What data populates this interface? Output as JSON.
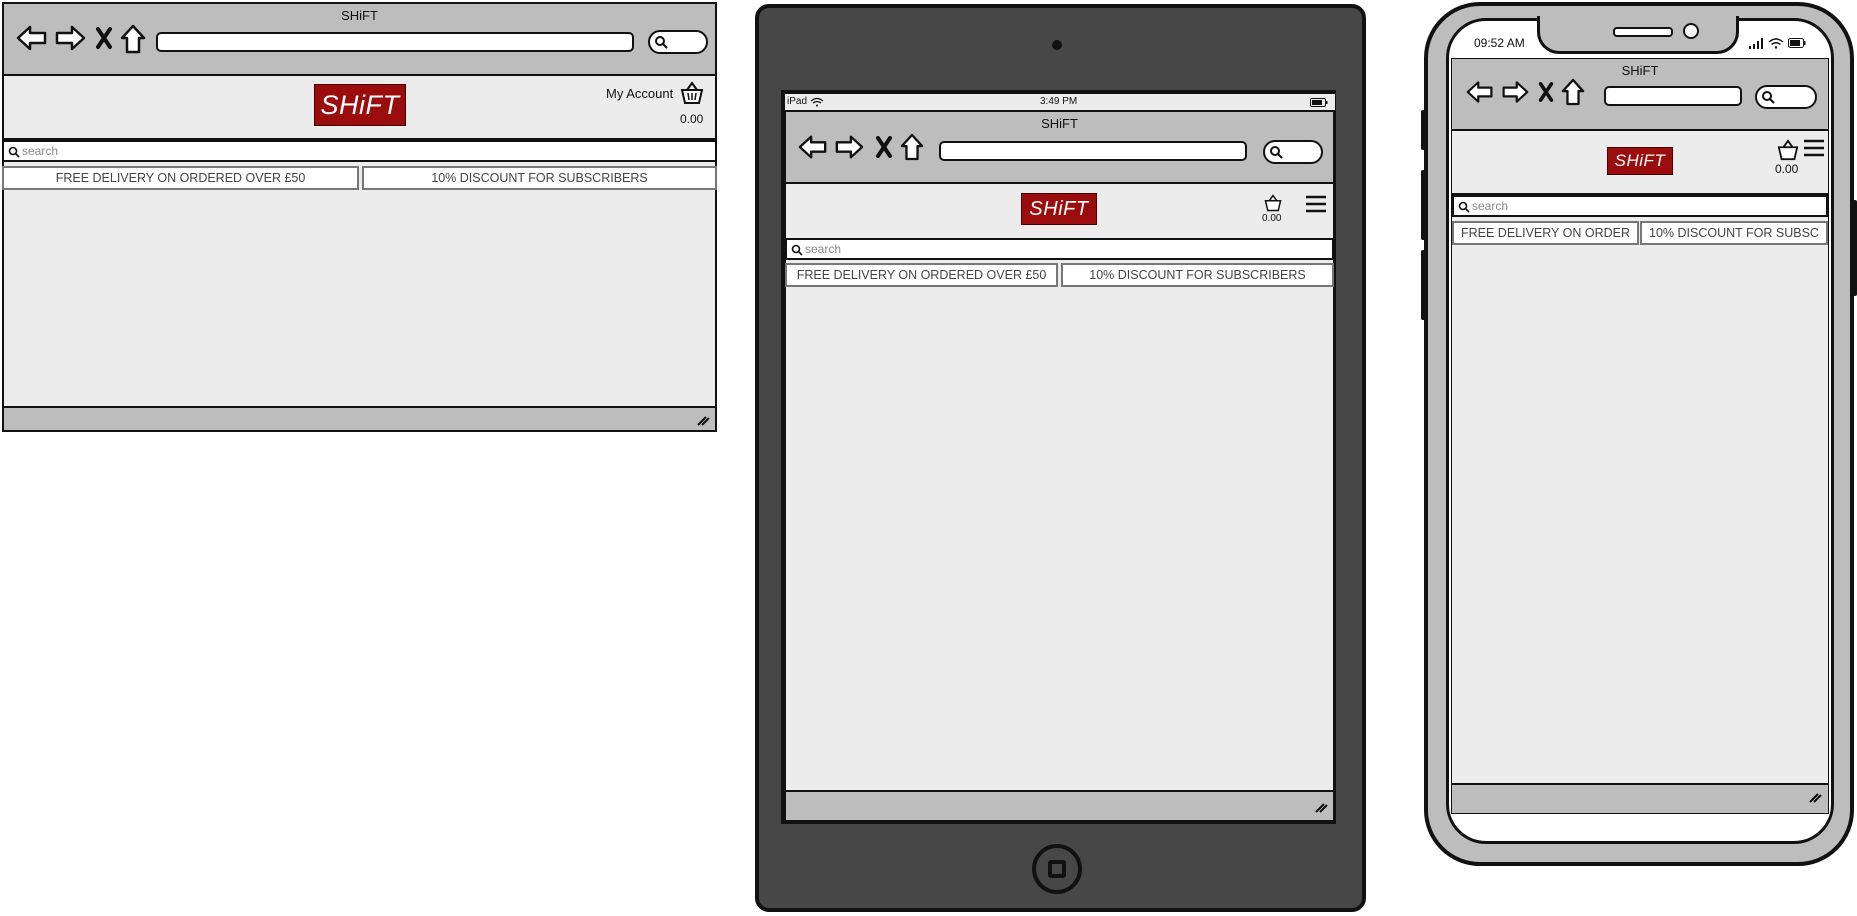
{
  "site_title": "SHiFT",
  "logo_text": "SHiFT",
  "search_placeholder": "search",
  "icons": {
    "back": "back-arrow-icon",
    "forward": "forward-arrow-icon",
    "stop": "close-icon",
    "home": "home-icon",
    "search": "search-icon",
    "basket": "basket-icon",
    "menu": "hamburger-menu-icon",
    "resize": "resize-grip-icon"
  },
  "colors": {
    "brand": "#9b0d0d",
    "chrome": "#bdbdbd",
    "page": "#ececec",
    "device": "#474747"
  },
  "desktop": {
    "account_label": "My Account",
    "basket_total": "0.00",
    "banners": [
      "FREE DELIVERY ON ORDERED OVER £50",
      "10% DISCOUNT FOR SUBSCRIBERS"
    ]
  },
  "tablet": {
    "device_label": "iPad",
    "clock": "3:49 PM",
    "basket_total": "0.00",
    "banners": [
      "FREE DELIVERY ON ORDERED OVER £50",
      "10% DISCOUNT FOR SUBSCRIBERS"
    ]
  },
  "phone": {
    "clock": "09:52 AM",
    "basket_total": "0.00",
    "banners": [
      "FREE DELIVERY ON ORDER",
      "10% DISCOUNT FOR SUBSC"
    ]
  }
}
